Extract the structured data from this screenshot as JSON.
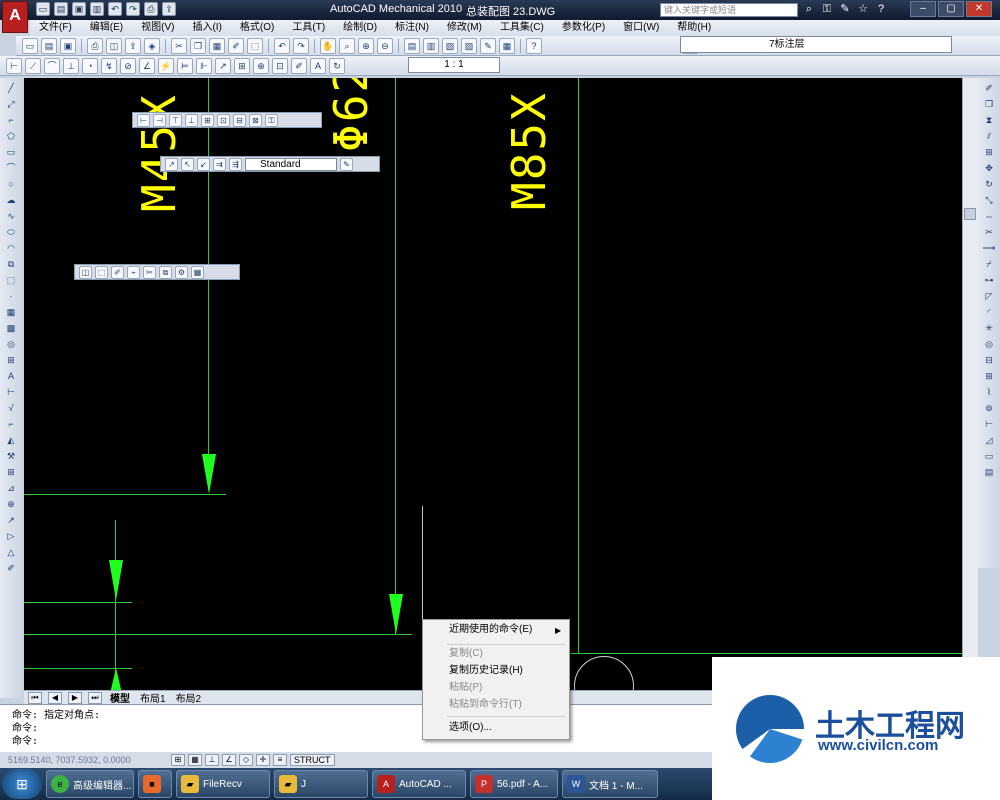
{
  "titlebar": {
    "app_title": "AutoCAD Mechanical 2010",
    "doc_title": "总装配图 23.DWG",
    "search_placeholder": "键入关键字或短语",
    "logo": "A"
  },
  "menu": [
    "文件(F)",
    "编辑(E)",
    "视图(V)",
    "插入(I)",
    "格式(O)",
    "工具(T)",
    "绘制(D)",
    "标注(N)",
    "修改(M)",
    "工具集(C)",
    "参数化(P)",
    "窗口(W)",
    "帮助(H)"
  ],
  "toolbars": {
    "layer_value": "7标注层",
    "scale_value": "1 : 1",
    "style_value": "Standard"
  },
  "drawing": {
    "labels": [
      "M45X",
      "Φ62",
      "M85X"
    ]
  },
  "tabs": {
    "model": "模型",
    "layout1": "布局1",
    "layout2": "布局2"
  },
  "command": {
    "line1": "命令: 指定对角点:",
    "line2": "命令:",
    "line3": "命令:"
  },
  "status": {
    "coords": "5169.5140, 7037.5932, 0.0000",
    "struct": "STRUCT"
  },
  "context_menu": {
    "items": [
      "近期使用的命令(E)",
      "复制(C)",
      "复制历史记录(H)",
      "粘贴(P)",
      "粘贴到命令行(T)",
      "选项(O)..."
    ]
  },
  "taskbar": {
    "items": [
      "高级编辑器...",
      "",
      "FileRecv",
      "J",
      "AutoCAD ...",
      "56.pdf - A...",
      "文档 1 - M..."
    ]
  },
  "watermark": {
    "title": "土木工程网",
    "url": "www.civilcn.com"
  },
  "colors": {
    "canvas": "#000000",
    "dim_line": "#31c931",
    "arrow": "#1fff1f",
    "text": "#ffff00"
  }
}
